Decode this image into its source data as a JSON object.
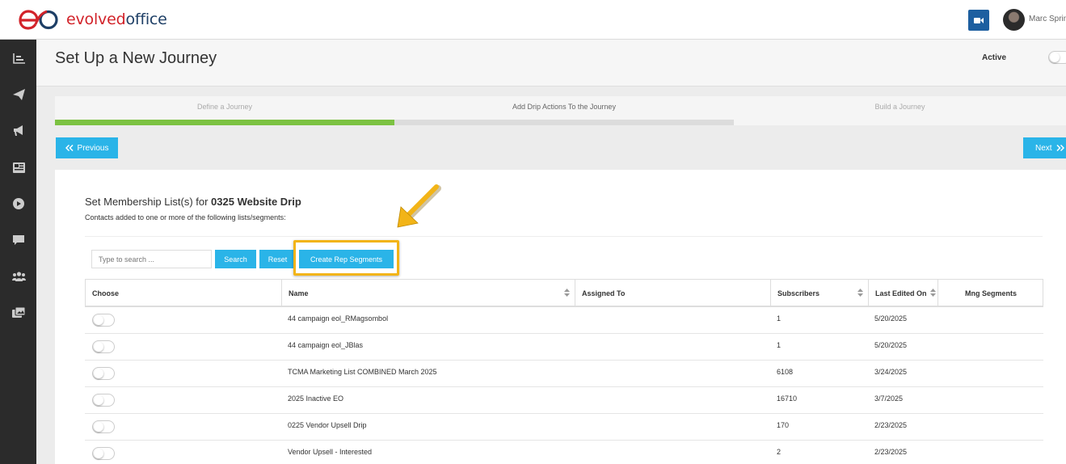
{
  "brand": {
    "logo_text_1": "evolved",
    "logo_text_2": "office",
    "color_red": "#d2232a",
    "color_navy": "#1e3f66"
  },
  "topbar": {
    "user_name": "Marc Sprin",
    "video_icon": "video-camera-icon"
  },
  "sidebar": {
    "items": [
      {
        "icon": "bar-chart-icon"
      },
      {
        "icon": "paper-plane-icon"
      },
      {
        "icon": "megaphone-icon"
      },
      {
        "icon": "newspaper-icon"
      },
      {
        "icon": "play-circle-icon"
      },
      {
        "icon": "chat-bubble-icon"
      },
      {
        "icon": "users-icon"
      },
      {
        "icon": "images-icon"
      }
    ]
  },
  "header": {
    "title": "Set Up a New Journey",
    "active_label": "Active",
    "close_label": "x"
  },
  "steps": [
    {
      "label": "Define a Journey",
      "state": "done"
    },
    {
      "label": "Add Drip Actions To the Journey",
      "state": "current"
    },
    {
      "label": "Build a Journey",
      "state": "pending"
    }
  ],
  "nav": {
    "previous_label": "Previous",
    "next_label": "Next"
  },
  "card": {
    "title_prefix": "Set Membership List(s) for ",
    "title_bold": "0325 Website Drip",
    "subtitle": "Contacts added to one or more of the following lists/segments:"
  },
  "search": {
    "placeholder": "Type to search ...",
    "search_label": "Search",
    "reset_label": "Reset",
    "create_label": "Create Rep Segments",
    "accent": "#2ab4e8",
    "highlight": "#f2b417"
  },
  "table": {
    "columns": [
      "Choose",
      "Name",
      "Assigned To",
      "Subscribers",
      "Last Edited On",
      "Mng Segments"
    ],
    "rows": [
      {
        "name": "44 campaign eol_RMagsombol",
        "assigned": "",
        "subscribers": "1",
        "edited": "5/20/2025"
      },
      {
        "name": "44 campaign eol_JBlas",
        "assigned": "",
        "subscribers": "1",
        "edited": "5/20/2025"
      },
      {
        "name": "TCMA Marketing List COMBINED March 2025",
        "assigned": "",
        "subscribers": "6108",
        "edited": "3/24/2025"
      },
      {
        "name": "2025 Inactive EO",
        "assigned": "",
        "subscribers": "16710",
        "edited": "3/7/2025"
      },
      {
        "name": "0225 Vendor Upsell Drip",
        "assigned": "",
        "subscribers": "170",
        "edited": "2/23/2025"
      },
      {
        "name": "Vendor Upsell - Interested",
        "assigned": "",
        "subscribers": "2",
        "edited": "2/23/2025"
      }
    ]
  }
}
